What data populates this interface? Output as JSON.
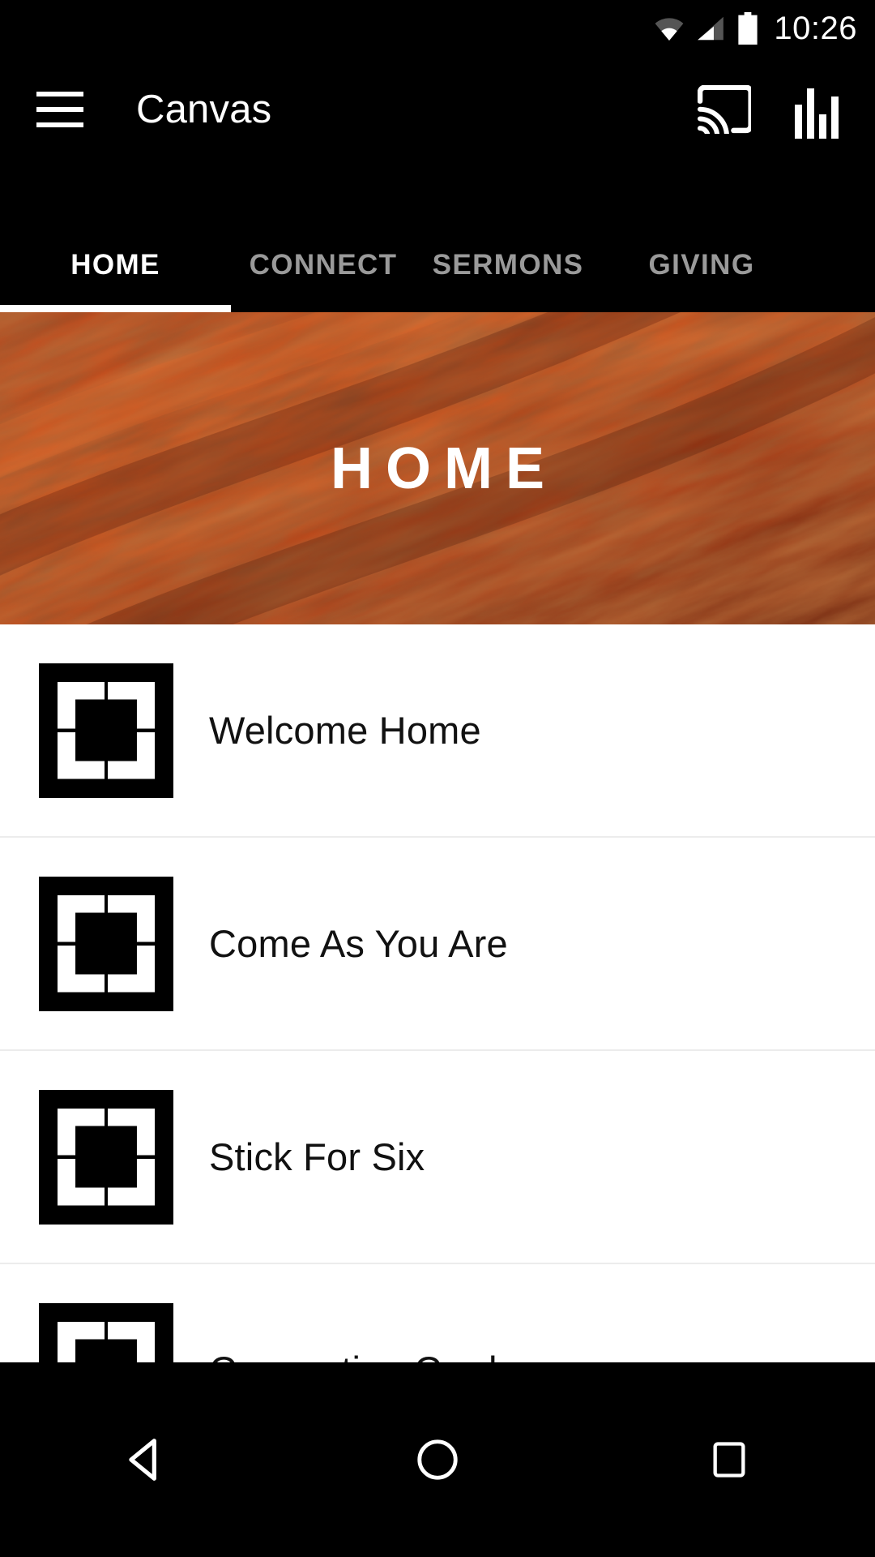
{
  "status_bar": {
    "time": "10:26",
    "icons": [
      "wifi-icon",
      "cellular-signal-icon",
      "battery-icon"
    ]
  },
  "toolbar": {
    "menu_icon": "hamburger-menu-icon",
    "title": "Canvas",
    "cast_icon": "cast-icon",
    "equalizer_icon": "bar-chart-icon"
  },
  "tabs": {
    "active_index": 0,
    "items": [
      {
        "label": "HOME"
      },
      {
        "label": "CONNECT"
      },
      {
        "label": "SERMONS"
      },
      {
        "label": "GIVING"
      }
    ]
  },
  "hero": {
    "title": "HOME",
    "background_color": "#c0380f",
    "accent_color": "#e8561c",
    "shadow_color": "#3a1008"
  },
  "list": {
    "items": [
      {
        "label": "Welcome Home",
        "icon": "fullscreen-expand-icon"
      },
      {
        "label": "Come As You Are",
        "icon": "fullscreen-expand-icon"
      },
      {
        "label": "Stick For Six",
        "icon": "fullscreen-expand-icon"
      },
      {
        "label": "Connection Card",
        "icon": "fullscreen-expand-icon"
      }
    ]
  },
  "nav_bar": {
    "back": "back-triangle-icon",
    "home": "home-circle-icon",
    "recents": "recents-square-icon"
  }
}
